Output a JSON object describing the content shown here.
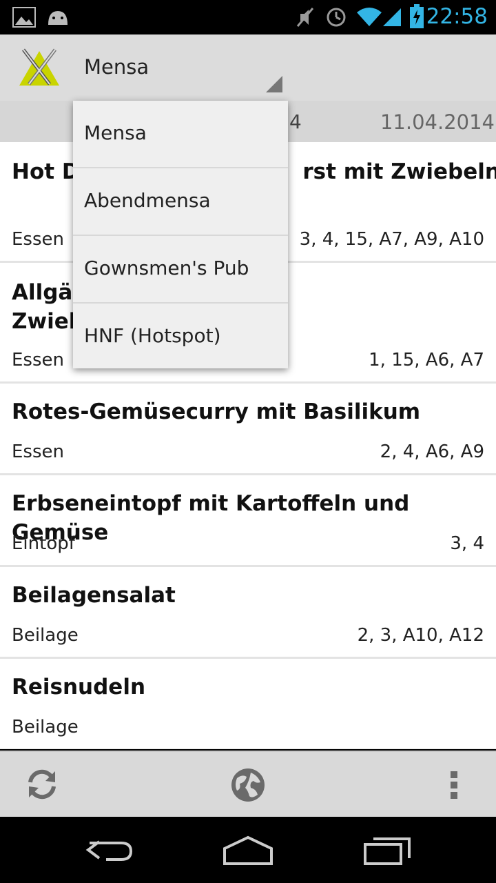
{
  "status_bar": {
    "time": "22:58",
    "left_icons": [
      "image-icon",
      "android-icon"
    ],
    "right_icons": [
      "mute-icon",
      "alarm-icon",
      "wifi-icon",
      "signal-icon",
      "battery-icon"
    ]
  },
  "action_bar": {
    "title": "Mensa",
    "logo": "mensa-logo-icon"
  },
  "date_strip": {
    "partial": "4",
    "date": "11.04.2014"
  },
  "menu_items": [
    {
      "title": "Hot D                              rst mit Zwiebeln und G",
      "category": "Essen",
      "codes": "3, 4, 15, A7, A9, A10"
    },
    {
      "title": "Allgäu\nZwieb",
      "category": "Essen",
      "codes": "1, 15, A6, A7"
    },
    {
      "title": "Rotes-Gemüsecurry mit Basilikum",
      "category": "Essen",
      "codes": "2, 4, A6, A9"
    },
    {
      "title": "Erbseneintopf mit Kartoffeln und Gemüse",
      "category": "Eintopf",
      "codes": "3, 4"
    },
    {
      "title": "Beilagensalat",
      "category": "Beilage",
      "codes": "2, 3, A10, A12"
    },
    {
      "title": "Reisnudeln",
      "category": "Beilage",
      "codes": ""
    }
  ],
  "dropdown": {
    "options": [
      "Mensa",
      "Abendmensa",
      "Gownsmen's Pub",
      "HNF (Hotspot)"
    ]
  },
  "bottom_bar": {
    "icons": [
      "refresh-icon",
      "globe-icon",
      "overflow-menu-icon"
    ]
  },
  "nav_bar": {
    "icons": [
      "back-icon",
      "home-icon",
      "recents-icon"
    ]
  },
  "colors": {
    "accent": "#33b5e5",
    "action_bar_bg": "#dcdcdc",
    "list_bg": "#ffffff"
  }
}
